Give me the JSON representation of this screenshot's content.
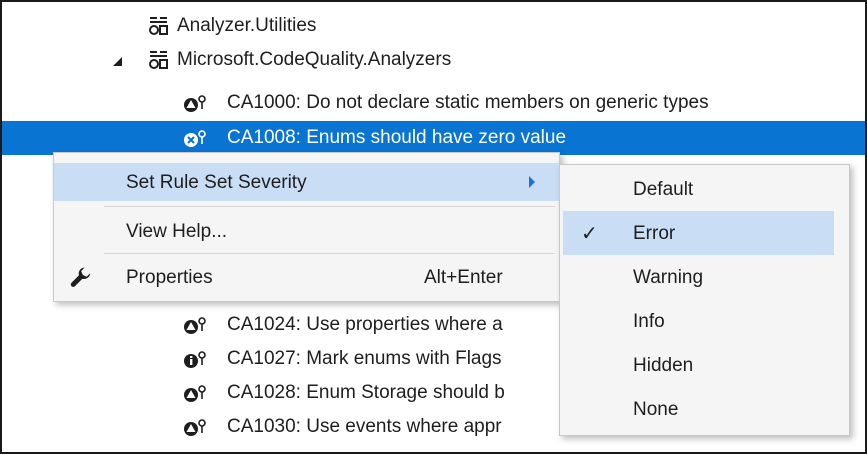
{
  "tree": {
    "rows": [
      {
        "label": "Analyzer.Utilities",
        "icon": "assembly-icon"
      },
      {
        "label": "Microsoft.CodeQuality.Analyzers",
        "icon": "assembly-icon",
        "expanded": true
      },
      {
        "label": "CA1000: Do not declare static members on generic types",
        "icon": "rule-warning-icon"
      },
      {
        "label": "CA1008: Enums should have zero value",
        "icon": "rule-error-icon",
        "selected": true
      },
      {
        "label": "CA1024: Use properties where a",
        "icon": "rule-warning-icon"
      },
      {
        "label": "CA1027: Mark enums with Flags",
        "icon": "rule-info-icon"
      },
      {
        "label": "CA1028: Enum Storage should b",
        "icon": "rule-warning-icon"
      },
      {
        "label": "CA1030: Use events where appr",
        "icon": "rule-warning-icon"
      }
    ]
  },
  "context_menu": {
    "items": [
      {
        "label": "Set Rule Set Severity",
        "has_submenu": true,
        "highlighted": true
      },
      {
        "label": "View Help..."
      },
      {
        "label": "Properties",
        "shortcut": "Alt+Enter",
        "icon": "wrench-icon"
      }
    ]
  },
  "severity_submenu": {
    "items": [
      {
        "label": "Default"
      },
      {
        "label": "Error",
        "checked": true,
        "check_glyph": "✓"
      },
      {
        "label": "Warning"
      },
      {
        "label": "Info"
      },
      {
        "label": "Hidden"
      },
      {
        "label": "None"
      }
    ]
  },
  "colors": {
    "selection": "#0a74d2",
    "menu_highlight": "#c9def5",
    "menu_background": "#f5f5f5"
  }
}
